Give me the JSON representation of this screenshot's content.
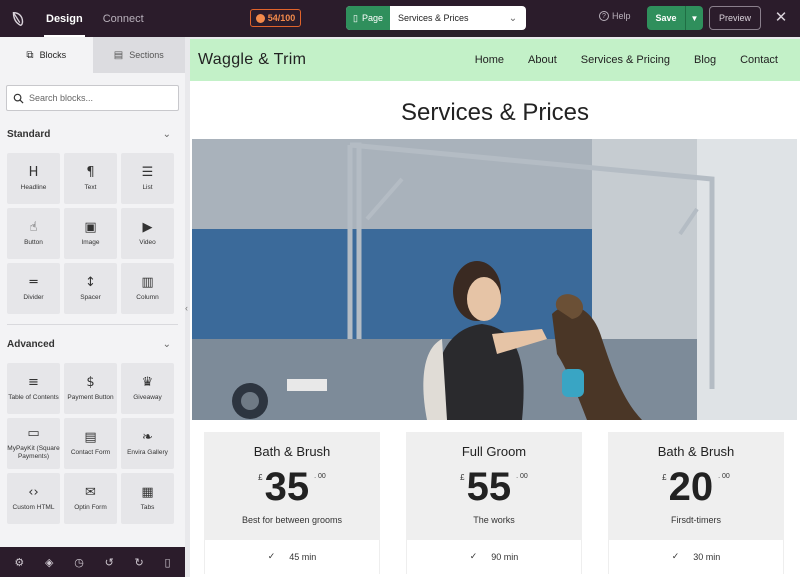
{
  "topbar": {
    "tabs": [
      {
        "label": "Design",
        "active": true
      },
      {
        "label": "Connect",
        "active": false
      }
    ],
    "score": "54/100",
    "page_tag": "Page",
    "page_name": "Services & Prices",
    "help": "Help",
    "save": "Save",
    "preview": "Preview"
  },
  "sidebar": {
    "tabs": [
      {
        "label": "Blocks",
        "active": true
      },
      {
        "label": "Sections",
        "active": false
      }
    ],
    "search_placeholder": "Search blocks...",
    "standard": {
      "title": "Standard",
      "blocks": [
        {
          "label": "Headline",
          "icon": "H"
        },
        {
          "label": "Text",
          "icon": "¶"
        },
        {
          "label": "List",
          "icon": "☰"
        },
        {
          "label": "Button",
          "icon": "☝"
        },
        {
          "label": "Image",
          "icon": "▣"
        },
        {
          "label": "Video",
          "icon": "▶"
        },
        {
          "label": "Divider",
          "icon": "═"
        },
        {
          "label": "Spacer",
          "icon": "↕"
        },
        {
          "label": "Column",
          "icon": "▥"
        }
      ]
    },
    "advanced": {
      "title": "Advanced",
      "blocks": [
        {
          "label": "Table of Contents",
          "icon": "≡"
        },
        {
          "label": "Payment Button",
          "icon": "$"
        },
        {
          "label": "Giveaway",
          "icon": "♛"
        },
        {
          "label": "MyPayKit (Square Payments)",
          "icon": "▭"
        },
        {
          "label": "Contact Form",
          "icon": "▤"
        },
        {
          "label": "Envira Gallery",
          "icon": "❧"
        },
        {
          "label": "Custom HTML",
          "icon": "‹›"
        },
        {
          "label": "Optin Form",
          "icon": "✉"
        },
        {
          "label": "Tabs",
          "icon": "▦"
        }
      ]
    }
  },
  "site": {
    "name": "Waggle & Trim",
    "nav": [
      "Home",
      "About",
      "Services & Pricing",
      "Blog",
      "Contact"
    ],
    "heading": "Services & Prices"
  },
  "cards": [
    {
      "title": "Bath & Brush",
      "currency": "£",
      "price": "35",
      "cents": ". 00",
      "desc": "Best for between grooms",
      "duration": "45 min"
    },
    {
      "title": "Full Groom",
      "currency": "£",
      "price": "55",
      "cents": ". 00",
      "desc": "The works",
      "duration": "90 min"
    },
    {
      "title": "Bath & Brush",
      "currency": "£",
      "price": "20",
      "cents": ". 00",
      "desc": "Firsdt-timers",
      "duration": "30 min"
    }
  ],
  "colors": {
    "topbar": "#2b1c2b",
    "accent": "#2f8f5c",
    "site_nav": "#c3f1c8",
    "score": "#f28a4b"
  }
}
